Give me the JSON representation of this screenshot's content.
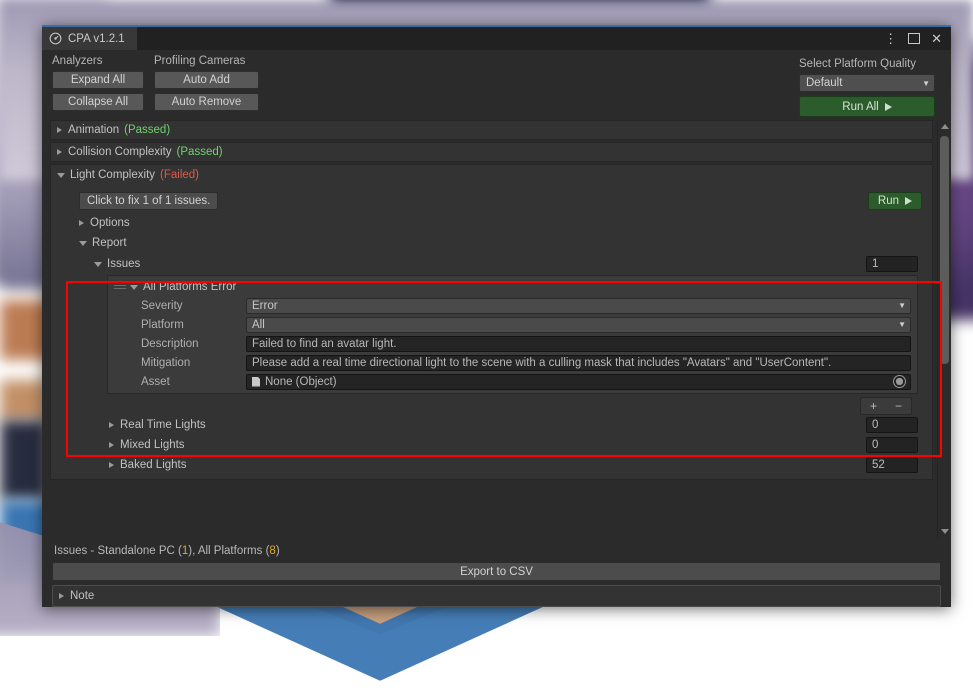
{
  "window": {
    "tab_title": "CPA v1.2.1",
    "icon": "gauge-icon",
    "controls": {
      "menu": "⋮",
      "maximize": "maximize-icon",
      "close": "✕"
    }
  },
  "toolbar": {
    "analyzers_label": "Analyzers",
    "cameras_label": "Profiling Cameras",
    "expand_all": "Expand All",
    "collapse_all": "Collapse All",
    "auto_add": "Auto Add",
    "auto_remove": "Auto Remove",
    "quality_label": "Select Platform Quality",
    "quality_value": "Default",
    "run_all": "Run All"
  },
  "analyzers": [
    {
      "name": "Animation",
      "status": "(Passed)",
      "state": "passed",
      "expanded": false
    },
    {
      "name": "Collision Complexity",
      "status": "(Passed)",
      "state": "passed",
      "expanded": false
    },
    {
      "name": "Light Complexity",
      "status": "(Failed)",
      "state": "failed",
      "expanded": true
    }
  ],
  "light_complexity": {
    "fix_button": "Click to fix 1 of 1 issues.",
    "run_button": "Run",
    "options_label": "Options",
    "report_label": "Report",
    "issues_label": "Issues",
    "issues_count": "1",
    "issue": {
      "title": "All Platforms Error",
      "fields": [
        {
          "label": "Severity",
          "value": "Error",
          "type": "popup"
        },
        {
          "label": "Platform",
          "value": "All",
          "type": "popup"
        },
        {
          "label": "Description",
          "value": "Failed to find an avatar light.",
          "type": "text"
        },
        {
          "label": "Mitigation",
          "value": "Please add a real time directional light to the scene with a culling mask that includes \"Avatars\" and \"UserContent\".",
          "type": "text"
        },
        {
          "label": "Asset",
          "value": "None (Object)",
          "type": "object"
        }
      ]
    },
    "add_label": "+",
    "remove_label": "−",
    "light_counts": [
      {
        "label": "Real Time Lights",
        "value": "0"
      },
      {
        "label": "Mixed Lights",
        "value": "0"
      },
      {
        "label": "Baked Lights",
        "value": "52"
      }
    ]
  },
  "footer": {
    "status_prefix": "Issues - Standalone PC (",
    "status_count_1": "1",
    "status_middle": "), All Platforms (",
    "status_count_2": "8",
    "status_suffix": ")",
    "export_button": "Export to CSV",
    "note_label": "Note"
  },
  "colors": {
    "accent_blue": "#3b6ea5",
    "pass_green": "#6fd36f",
    "fail_red": "#e05b4a",
    "run_green": "#2c5b2c",
    "highlight_red": "#ff0000",
    "amber": "#e0a92a"
  }
}
